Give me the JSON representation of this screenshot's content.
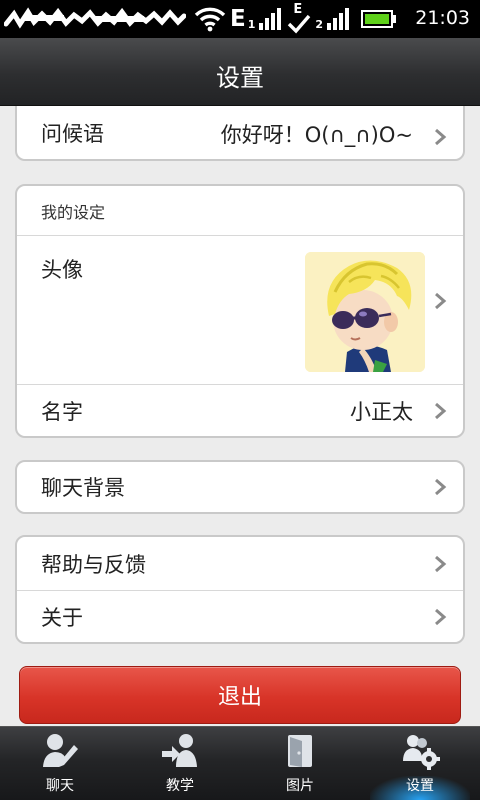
{
  "status_bar": {
    "network_letter_1": "E",
    "signal_1_index": "1",
    "network_letter_2": "E",
    "signal_2_index": "2",
    "time": "21:03",
    "icons": [
      "wifi-icon",
      "signal-icon",
      "checkmark-icon",
      "battery-icon"
    ]
  },
  "header": {
    "title": "设置"
  },
  "greeting": {
    "label": "问候语",
    "value": "你好呀！O(∩_∩)O~"
  },
  "my_settings": {
    "section_title": "我的设定",
    "avatar_label": "头像",
    "name_label": "名字",
    "name_value": "小正太"
  },
  "chat_background": {
    "label": "聊天背景"
  },
  "help": {
    "feedback_label": "帮助与反馈",
    "about_label": "关于"
  },
  "logout": {
    "label": "退出",
    "color": "#d83428"
  },
  "bottom_nav": {
    "items": [
      {
        "label": "聊天",
        "icon": "chat-pen-icon"
      },
      {
        "label": "教学",
        "icon": "teach-icon"
      },
      {
        "label": "图片",
        "icon": "picture-door-icon"
      },
      {
        "label": "设置",
        "icon": "settings-users-icon",
        "active": true
      }
    ],
    "active_color": "#28aaff"
  }
}
